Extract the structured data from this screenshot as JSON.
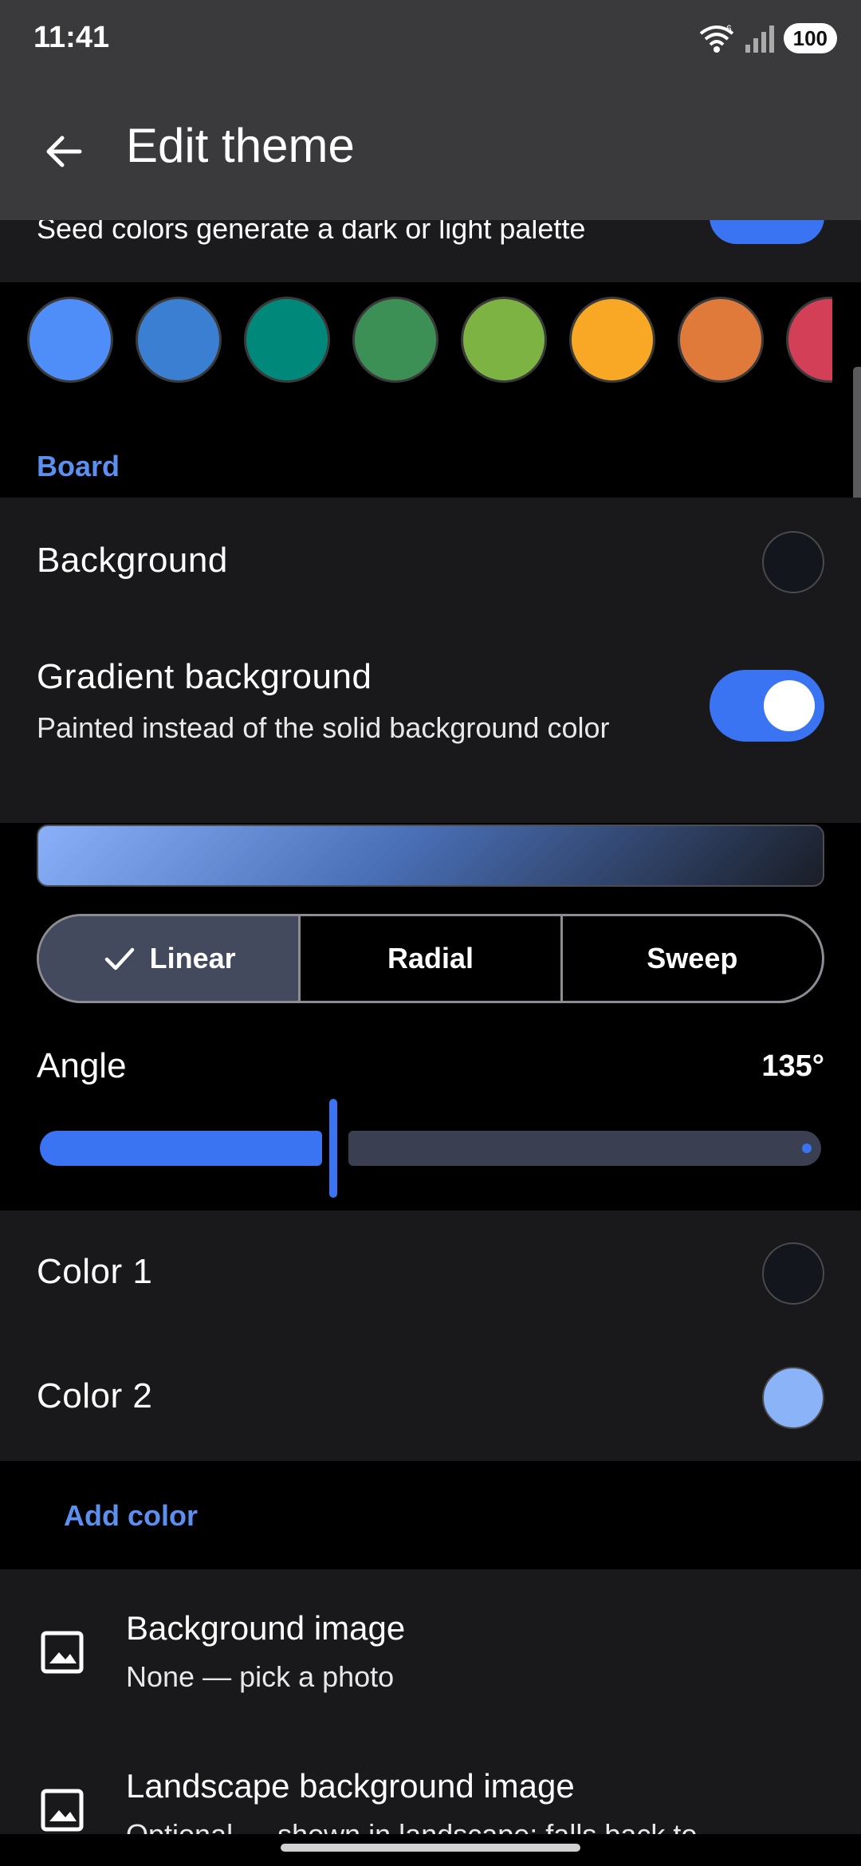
{
  "status_bar": {
    "time": "11:41",
    "battery": "100",
    "wifi_badge": "6"
  },
  "app_bar": {
    "title": "Edit theme",
    "back_icon": "arrow-left-icon"
  },
  "seed_row": {
    "text": "Seed colors generate a dark or light palette",
    "enabled": true
  },
  "swatches": [
    "#4f8df8",
    "#3b7fd2",
    "#00897b",
    "#3c8f55",
    "#7cb342",
    "#f9a825",
    "#e07a3a",
    "#d23f57"
  ],
  "board": {
    "header": "Board",
    "background": {
      "label": "Background",
      "color": "#14161d"
    },
    "gradient": {
      "title": "Gradient background",
      "subtitle": "Painted instead of the solid background color",
      "enabled": true
    },
    "gradient_types": [
      {
        "label": "Linear",
        "selected": true
      },
      {
        "label": "Radial",
        "selected": false
      },
      {
        "label": "Sweep",
        "selected": false
      }
    ],
    "angle": {
      "label": "Angle",
      "value_text": "135°",
      "value": 135,
      "max": 360
    },
    "colors": [
      {
        "label": "Color 1",
        "color": "#14161d"
      },
      {
        "label": "Color 2",
        "color": "#8ab3f8"
      }
    ],
    "add_color_label": "Add color"
  },
  "images": [
    {
      "title": "Background image",
      "subtitle": "None — pick a photo"
    },
    {
      "title": "Landscape background image",
      "subtitle": "Optional — shown in landscape; falls back to"
    }
  ]
}
